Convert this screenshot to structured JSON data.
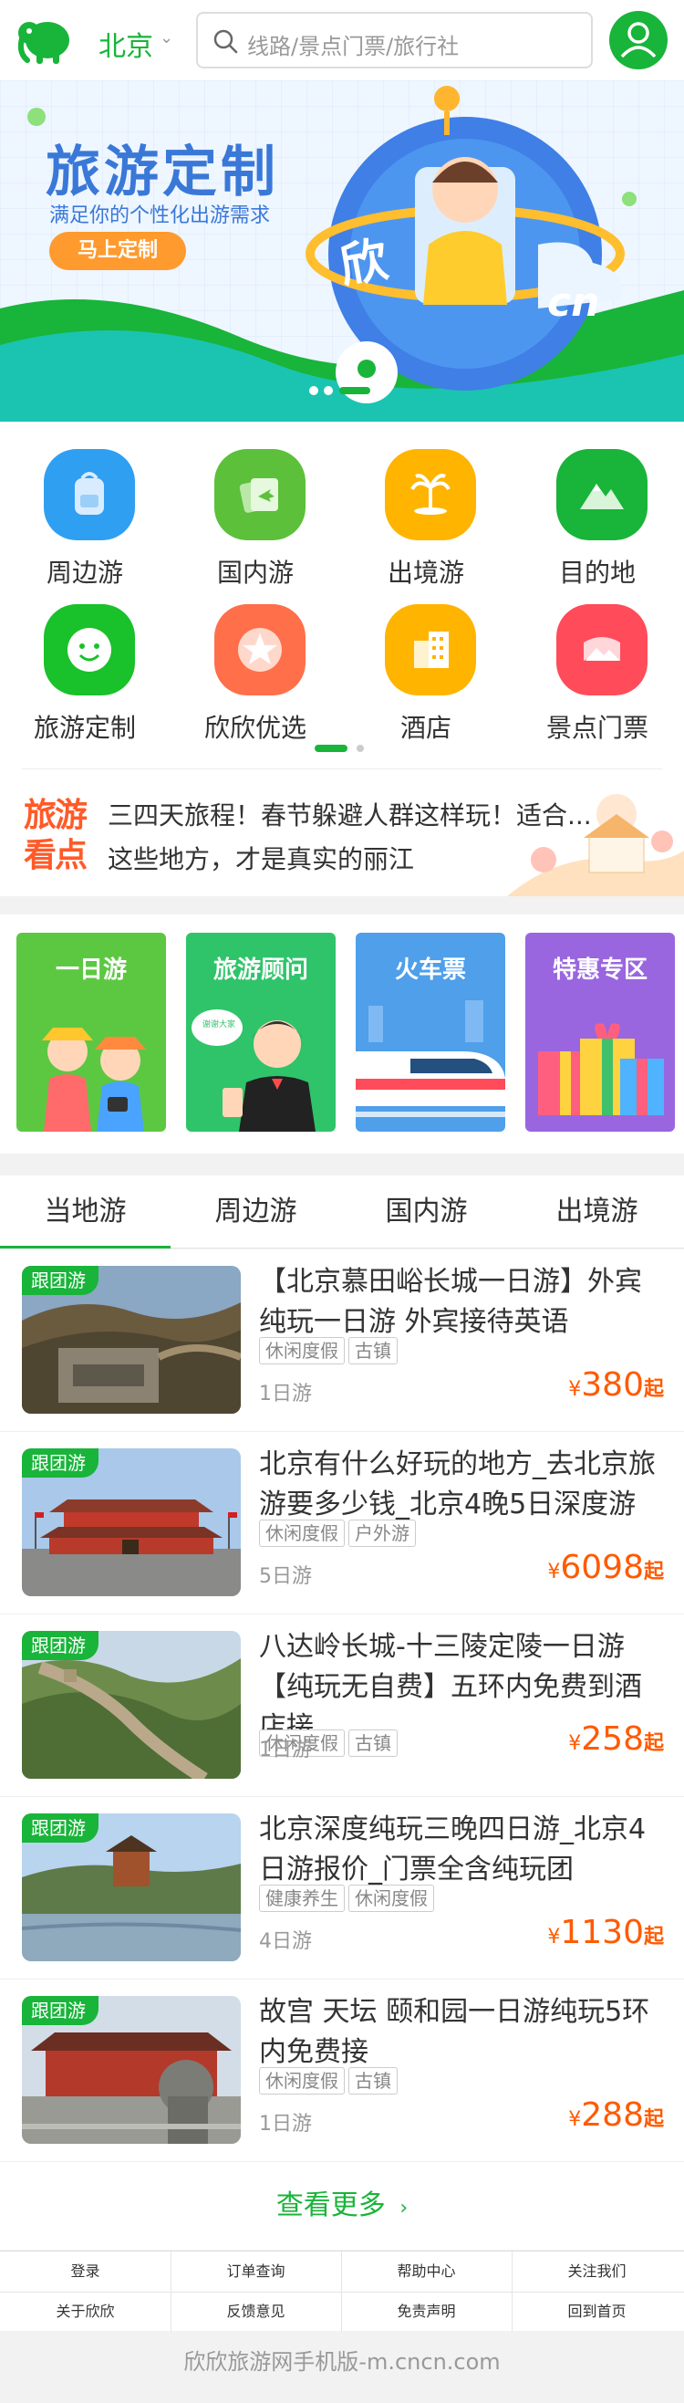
{
  "header": {
    "city": "北京",
    "search_placeholder": "线路/景点门票/旅行社"
  },
  "banner": {
    "title": "旅游定制",
    "subtitle": "满足你的个性化出游需求",
    "button": "马上定制",
    "circle_text_1": "欣",
    "circle_text_2": "cn"
  },
  "nav": [
    {
      "label": "周边游",
      "icon": "backpack-icon",
      "color": "#2f9ff2"
    },
    {
      "label": "国内游",
      "icon": "plane-ticket-icon",
      "color": "#5cc03a"
    },
    {
      "label": "出境游",
      "icon": "palm-island-icon",
      "color": "#ffb400"
    },
    {
      "label": "目的地",
      "icon": "mountain-icon",
      "color": "#19b43a"
    },
    {
      "label": "旅游定制",
      "icon": "smile-icon",
      "color": "#19c12a"
    },
    {
      "label": "欣欣优选",
      "icon": "star-icon",
      "color": "#ff6f4a"
    },
    {
      "label": "酒店",
      "icon": "building-icon",
      "color": "#ffb400"
    },
    {
      "label": "景点门票",
      "icon": "landscape-icon",
      "color": "#ff4b5a"
    }
  ],
  "headline": {
    "logo_line1": "旅游",
    "logo_line2": "看点",
    "line1": "三四天旅程！春节躲避人群这样玩！适合...",
    "line2": "这些地方，才是真实的丽江"
  },
  "cards": [
    {
      "title": "一日游",
      "color": "#5cc842"
    },
    {
      "title": "旅游顾问",
      "color": "#2fc46a"
    },
    {
      "title": "火车票",
      "color": "#4f9fea"
    },
    {
      "title": "特惠专区",
      "color": "#9966e0"
    }
  ],
  "card_sign_text": "谢谢大家",
  "tabs": [
    "当地游",
    "周边游",
    "国内游",
    "出境游"
  ],
  "list": [
    {
      "badge": "跟团游",
      "title": "【北京慕田峪长城一日游】外宾纯玩一日游 外宾接待英语",
      "tags": [
        "休闲度假",
        "古镇"
      ],
      "days": "1日游",
      "currency": "¥",
      "price": "380",
      "suffix": "起"
    },
    {
      "badge": "跟团游",
      "title": "北京有什么好玩的地方_去北京旅游要多少钱_北京4晚5日深度游",
      "tags": [
        "休闲度假",
        "户外游"
      ],
      "days": "5日游",
      "currency": "¥",
      "price": "6098",
      "suffix": "起"
    },
    {
      "badge": "跟团游",
      "title": "八达岭长城-十三陵定陵一日游【纯玩无自费】五环内免费到酒店接",
      "tags": [
        "休闲度假",
        "古镇"
      ],
      "days": "1日游",
      "currency": "¥",
      "price": "258",
      "suffix": "起"
    },
    {
      "badge": "跟团游",
      "title": "北京深度纯玩三晚四日游_北京4日游报价_门票全含纯玩团",
      "tags": [
        "健康养生",
        "休闲度假"
      ],
      "days": "4日游",
      "currency": "¥",
      "price": "1130",
      "suffix": "起"
    },
    {
      "badge": "跟团游",
      "title": "故宫 天坛 颐和园一日游纯玩5环内免费接",
      "tags": [
        "休闲度假",
        "古镇"
      ],
      "days": "1日游",
      "currency": "¥",
      "price": "288",
      "suffix": "起"
    }
  ],
  "more": "查看更多",
  "footer_links": [
    "登录",
    "订单查询",
    "帮助中心",
    "关注我们",
    "关于欣欣",
    "反馈意见",
    "免责声明",
    "回到首页"
  ],
  "copyright": "欣欣旅游网手机版-m.cncn.com"
}
